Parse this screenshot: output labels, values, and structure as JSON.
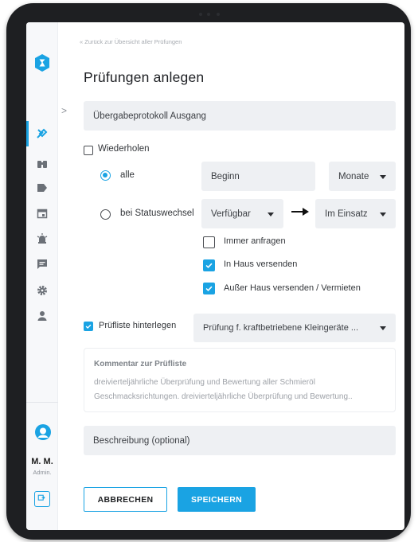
{
  "colors": {
    "accent": "#1aa3e3",
    "field_bg": "#eef0f3",
    "device_frame": "#1e1f22"
  },
  "nav": {
    "back_link": "« Zurück zur Übersicht aller Prüfungen",
    "collapse_symbol": ">",
    "icons": [
      "tools-icon",
      "binoculars-icon",
      "tag-icon",
      "calendar-icon",
      "alarm-icon",
      "message-icon",
      "gear-icon",
      "person-icon"
    ],
    "active_icon": "tools-icon"
  },
  "user": {
    "initials": "M. M.",
    "role": "Admin."
  },
  "page": {
    "title": "Prüfungen anlegen"
  },
  "form": {
    "name_value": "Übergabeprotokoll Ausgang",
    "repeat": {
      "label": "Wiederholen",
      "checked": false
    },
    "interval": {
      "option_label": "alle",
      "selected": true,
      "begin_placeholder": "Beginn",
      "unit_value": "Monate"
    },
    "status_change": {
      "option_label": "bei Statuswechsel",
      "selected": false,
      "from_value": "Verfügbar",
      "to_value": "Im Einsatz"
    },
    "options": [
      {
        "label": "Immer anfragen",
        "checked": false
      },
      {
        "label": "In Haus versenden",
        "checked": true
      },
      {
        "label": "Außer Haus versenden / Vermieten",
        "checked": true
      }
    ],
    "checklist": {
      "label": "Prüfliste hinterlegen",
      "checked": true,
      "value": "Prüfung f. kraftbetriebene Kleingeräte ..."
    },
    "comment": {
      "title": "Kommentar zur Prüfliste",
      "line1": "dreivierteljährliche Überprüfung und Bewertung aller Schmieröl",
      "line2": "Geschmacksrichtungen. dreivierteljährliche Überprüfung und Bewertung.."
    },
    "description_placeholder": "Beschreibung (optional)"
  },
  "actions": {
    "cancel_label": "ABBRECHEN",
    "save_label": "SPEICHERN"
  }
}
